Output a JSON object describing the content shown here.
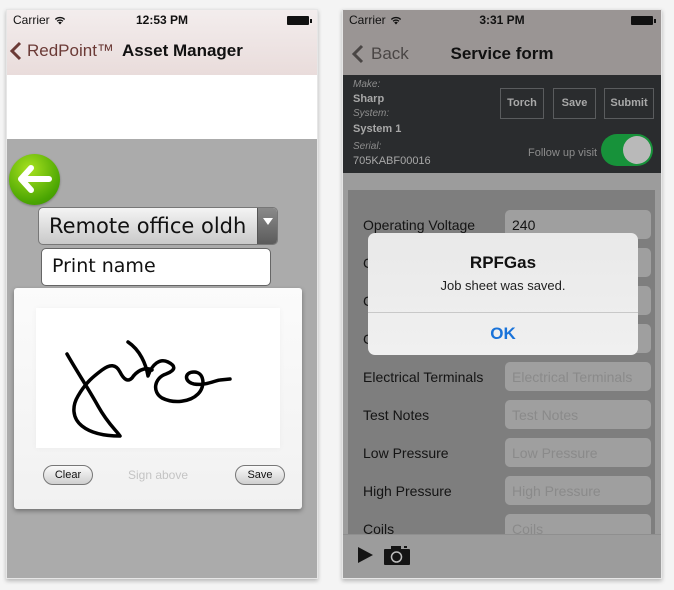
{
  "left_screen": {
    "status": {
      "carrier": "Carrier",
      "time": "12:53 PM"
    },
    "navbar": {
      "back_label": "RedPoint™",
      "title": "Asset Manager"
    },
    "office_select": {
      "value": "Remote office oldh"
    },
    "print_name": {
      "placeholder": "Print name"
    },
    "signature": {
      "clear_label": "Clear",
      "hint": "Sign above",
      "save_label": "Save"
    }
  },
  "right_screen": {
    "status": {
      "carrier": "Carrier",
      "time": "3:31 PM"
    },
    "navbar": {
      "back_label": "Back",
      "title": "Service form"
    },
    "panel": {
      "make_label": "Make:",
      "make_value": "Sharp",
      "system_label": "System:",
      "system_value": "System 1",
      "serial_label": "Serial:",
      "serial_value": "705KABF00016",
      "buttons": [
        "Torch",
        "Save",
        "Submit"
      ],
      "follow_up_label": "Follow up visit",
      "follow_up_on": true
    },
    "form_rows": [
      {
        "label": "Operating Voltage",
        "value": "240",
        "placeholder": ""
      },
      {
        "label": "C",
        "value": "",
        "placeholder": ""
      },
      {
        "label": "C",
        "value": "",
        "placeholder": ""
      },
      {
        "label": "C",
        "value": "",
        "placeholder": ""
      },
      {
        "label": "Electrical Terminals",
        "value": "",
        "placeholder": "Electrical Terminals"
      },
      {
        "label": "Test Notes",
        "value": "",
        "placeholder": "Test Notes"
      },
      {
        "label": "Low Pressure",
        "value": "",
        "placeholder": "Low Pressure"
      },
      {
        "label": "High Pressure",
        "value": "",
        "placeholder": "High Pressure"
      },
      {
        "label": "Coils",
        "value": "",
        "placeholder": "Coils"
      }
    ],
    "alert": {
      "title": "RPFGas",
      "message": "Job sheet was saved.",
      "ok_label": "OK"
    },
    "toolbar": {
      "icons": [
        "play-icon",
        "camera-icon"
      ]
    }
  },
  "colors": {
    "toggle_on": "#17923a",
    "alert_button": "#1a73d9",
    "left_back_label": "#6b3a36",
    "green_button": "#4aa502"
  }
}
